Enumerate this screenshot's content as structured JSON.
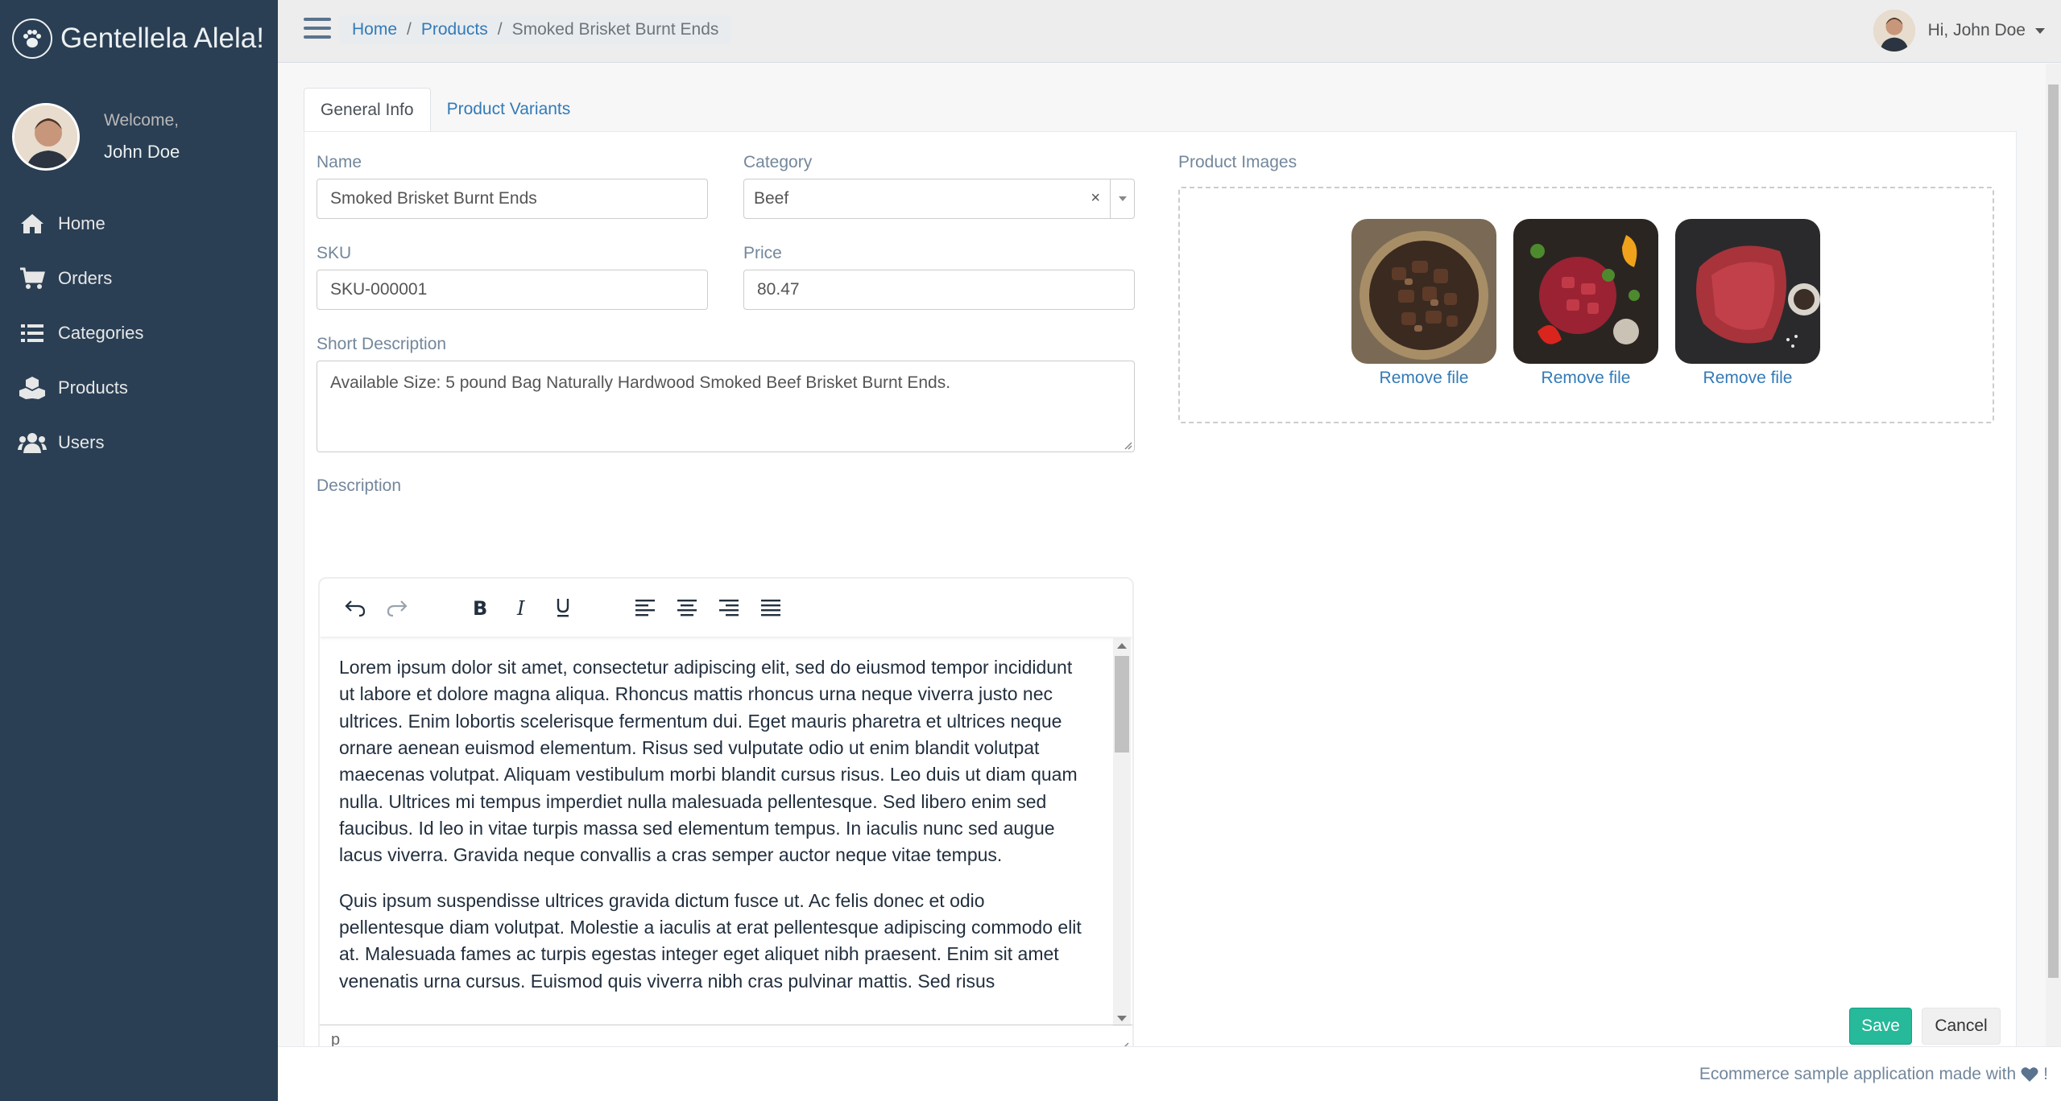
{
  "app": {
    "title": "Gentellela Alela!",
    "logo_icon": "paw-icon"
  },
  "profile": {
    "welcome": "Welcome,",
    "name": "John Doe"
  },
  "sidebar": {
    "items": [
      {
        "label": "Home",
        "icon": "home-icon"
      },
      {
        "label": "Orders",
        "icon": "shopping-cart-icon"
      },
      {
        "label": "Categories",
        "icon": "list-icon"
      },
      {
        "label": "Products",
        "icon": "cubes-icon"
      },
      {
        "label": "Users",
        "icon": "users-icon"
      }
    ]
  },
  "breadcrumb": {
    "home": "Home",
    "products": "Products",
    "current": "Smoked Brisket Burnt Ends",
    "separator": "/"
  },
  "user_menu": {
    "greeting": "Hi, John Doe"
  },
  "tabs": [
    {
      "label": "General Info"
    },
    {
      "label": "Product Variants"
    }
  ],
  "form": {
    "name_label": "Name",
    "name_value": "Smoked Brisket Burnt Ends",
    "category_label": "Category",
    "category_value": "Beef",
    "category_clear": "×",
    "sku_label": "SKU",
    "sku_value": "SKU-000001",
    "price_label": "Price",
    "price_value": "80.47",
    "short_desc_label": "Short Description",
    "short_desc_value": "Available Size: 5 pound Bag Naturally Hardwood Smoked Beef Brisket Burnt Ends.",
    "description_label": "Description",
    "images_label": "Product Images"
  },
  "editor": {
    "paragraphs": [
      "Lorem ipsum dolor sit amet, consectetur adipiscing elit, sed do eiusmod tempor incididunt ut labore et dolore magna aliqua. Rhoncus mattis rhoncus urna neque viverra justo nec ultrices. Enim lobortis scelerisque fermentum dui. Eget mauris pharetra et ultrices neque ornare aenean euismod elementum. Risus sed vulputate odio ut enim blandit volutpat maecenas volutpat. Aliquam vestibulum morbi blandit cursus risus. Leo duis ut diam quam nulla. Ultrices mi tempus imperdiet nulla malesuada pellentesque. Sed libero enim sed faucibus. Id leo in vitae turpis massa sed elementum tempus. In iaculis nunc sed augue lacus viverra. Gravida neque convallis a cras semper auctor neque vitae tempus.",
      "Quis ipsum suspendisse ultrices gravida dictum fusce ut. Ac felis donec et odio pellentesque diam volutpat. Molestie a iaculis at erat pellentesque adipiscing commodo elit at. Malesuada fames ac turpis egestas integer eget aliquet nibh praesent. Enim sit amet venenatis urna cursus. Euismod quis viverra nibh cras pulvinar mattis. Sed risus"
    ],
    "status_path": "p"
  },
  "images": [
    {
      "remove_label": "Remove file"
    },
    {
      "remove_label": "Remove file"
    },
    {
      "remove_label": "Remove file"
    }
  ],
  "actions": {
    "save": "Save",
    "cancel": "Cancel"
  },
  "footer": {
    "text": "Ecommerce sample application made with",
    "suffix": "!"
  },
  "colors": {
    "sidebar": "#2a3f54",
    "accent_green": "#26b99a",
    "link": "#337ab7"
  }
}
